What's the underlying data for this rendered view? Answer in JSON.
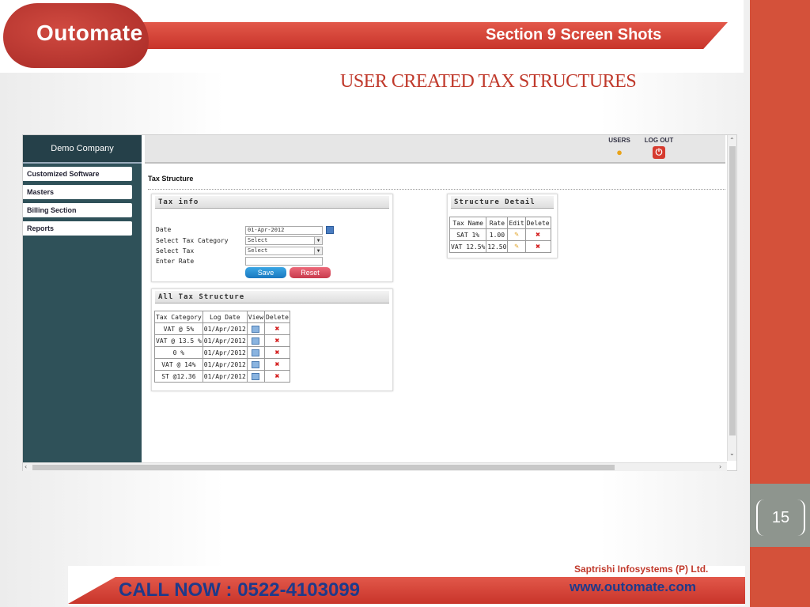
{
  "slide": {
    "logo": "Outomate",
    "section_title": "Section 9  Screen Shots",
    "title": "USER CREATED  TAX  STRUCTURES",
    "page_number": "15",
    "call_now": "CALL NOW :  0522-4103099",
    "company": "Saptrishi Infosystems (P) Ltd.",
    "website": "www.outomate.com"
  },
  "app": {
    "company_name": "Demo Company",
    "menu": [
      {
        "label": "Customized Software"
      },
      {
        "label": "Masters"
      },
      {
        "label": "Billing Section"
      },
      {
        "label": "Reports"
      }
    ],
    "topbar": {
      "users_label": "USERS",
      "logout_label": "LOG OUT"
    },
    "page_title": "Tax Structure",
    "tax_info": {
      "heading": "Tax info",
      "date_label": "Date",
      "date_value": "01-Apr-2012",
      "category_label": "Select Tax Category",
      "category_value": "Select",
      "tax_label": "Select Tax",
      "tax_value": "Select",
      "rate_label": "Enter Rate",
      "rate_value": "",
      "save_label": "Save",
      "reset_label": "Reset"
    },
    "all_tax": {
      "heading": "All Tax Structure",
      "columns": [
        "Tax Category",
        "Log Date",
        "View",
        "Delete"
      ],
      "rows": [
        {
          "category": "VAT @ 5%",
          "date": "01/Apr/2012"
        },
        {
          "category": "VAT @ 13.5 %",
          "date": "01/Apr/2012"
        },
        {
          "category": "0 %",
          "date": "01/Apr/2012"
        },
        {
          "category": "VAT @ 14%",
          "date": "01/Apr/2012"
        },
        {
          "category": "ST @12.36",
          "date": "01/Apr/2012"
        }
      ]
    },
    "structure_detail": {
      "heading": "Structure Detail",
      "columns": [
        "Tax Name",
        "Rate",
        "Edit",
        "Delete"
      ],
      "rows": [
        {
          "name": "SAT 1%",
          "rate": "1.00"
        },
        {
          "name": "VAT 12.5%",
          "rate": "12.50"
        }
      ]
    }
  },
  "colors": {
    "accent_red": "#d4513a",
    "sidebar": "#2f5159",
    "title_red": "#c0392b",
    "footer_blue": "#1e3a8a"
  }
}
